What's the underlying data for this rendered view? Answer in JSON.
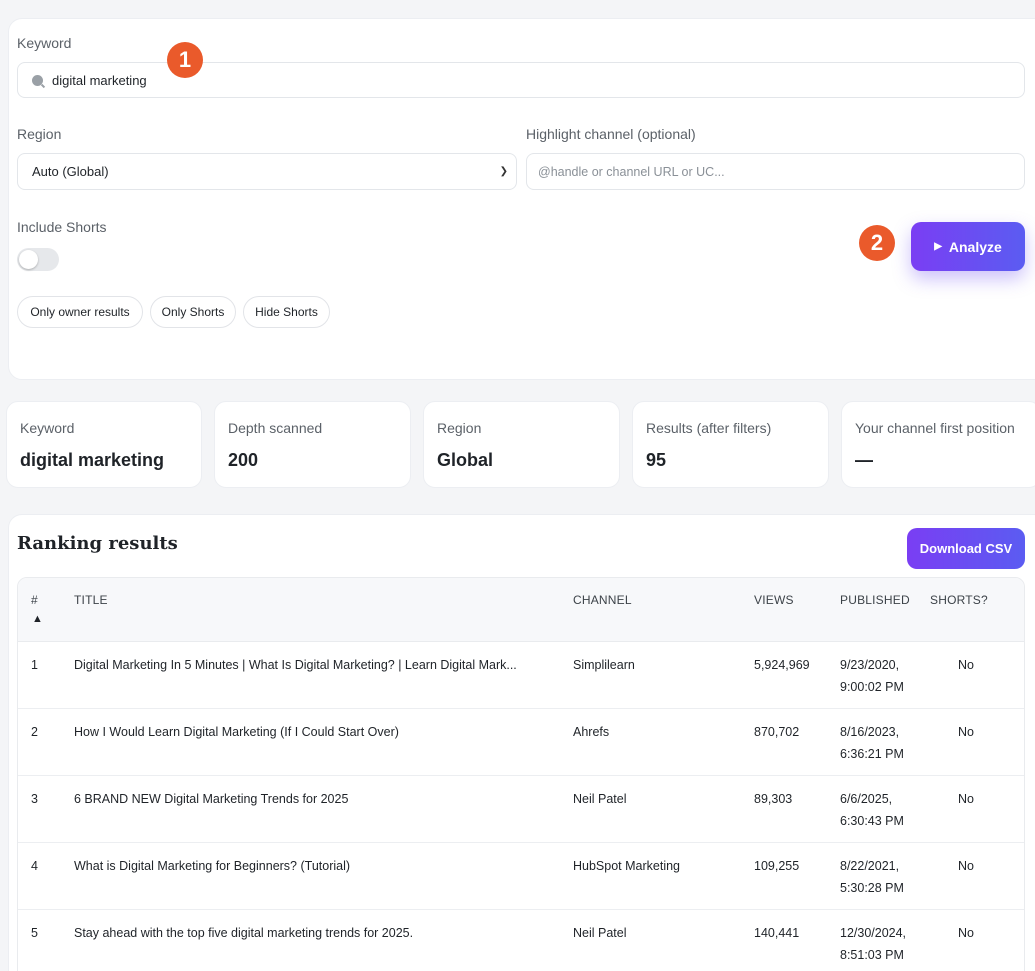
{
  "form": {
    "keyword_label": "Keyword",
    "keyword_value": "digital marketing",
    "region_label": "Region",
    "region_value": "Auto (Global)",
    "highlight_label": "Highlight channel (optional)",
    "highlight_placeholder": "@handle or channel URL or UC...",
    "include_shorts_label": "Include Shorts",
    "include_shorts_on": false,
    "filters": [
      "Only owner results",
      "Only Shorts",
      "Hide Shorts"
    ],
    "analyze_label": "Analyze"
  },
  "annotations": [
    "1",
    "2"
  ],
  "stats": [
    {
      "label": "Keyword",
      "value": "digital marketing"
    },
    {
      "label": "Depth scanned",
      "value": "200"
    },
    {
      "label": "Region",
      "value": "Global"
    },
    {
      "label": "Results (after filters)",
      "value": "95"
    },
    {
      "label": "Your channel first position",
      "value": "—"
    }
  ],
  "results": {
    "title": "Ranking results",
    "download_label": "Download CSV",
    "columns": [
      "#",
      "TITLE",
      "CHANNEL",
      "VIEWS",
      "PUBLISHED",
      "SHORTS?"
    ],
    "sort_indicator": "▲",
    "rows": [
      {
        "rank": "1",
        "title": "Digital Marketing In 5 Minutes | What Is Digital Marketing? | Learn Digital Mark...",
        "channel": "Simplilearn",
        "views": "5,924,969",
        "published_date": "9/23/2020,",
        "published_time": "9:00:02 PM",
        "shorts": "No"
      },
      {
        "rank": "2",
        "title": "How I Would Learn Digital Marketing (If I Could Start Over)",
        "channel": "Ahrefs",
        "views": "870,702",
        "published_date": "8/16/2023,",
        "published_time": "6:36:21 PM",
        "shorts": "No"
      },
      {
        "rank": "3",
        "title": "6 BRAND NEW Digital Marketing Trends for 2025",
        "channel": "Neil Patel",
        "views": "89,303",
        "published_date": "6/6/2025,",
        "published_time": "6:30:43 PM",
        "shorts": "No"
      },
      {
        "rank": "4",
        "title": "What is Digital Marketing for Beginners? (Tutorial)",
        "channel": "HubSpot Marketing",
        "views": "109,255",
        "published_date": "8/22/2021,",
        "published_time": "5:30:28 PM",
        "shorts": "No"
      },
      {
        "rank": "5",
        "title": "Stay ahead with the top five digital marketing trends for 2025.",
        "channel": "Neil Patel",
        "views": "140,441",
        "published_date": "12/30/2024,",
        "published_time": "8:51:03 PM",
        "shorts": "No"
      }
    ]
  },
  "colors": {
    "accent_start": "#7a3ef3",
    "accent_end": "#5b5cf2",
    "annotation_badge": "#ea5a2b",
    "page_background": "#f4f5f7"
  }
}
